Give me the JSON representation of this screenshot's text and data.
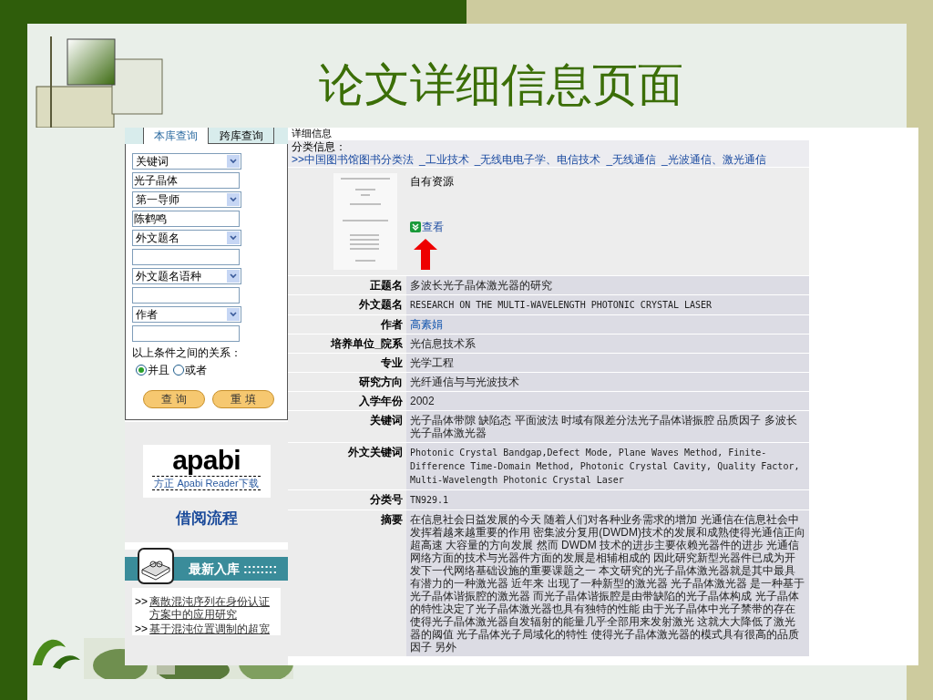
{
  "slide_title": "论文详细信息页面",
  "search_panel": {
    "tabs": [
      {
        "label": "本库查询",
        "selected": true
      },
      {
        "label": "跨库查询",
        "selected": false
      }
    ],
    "fields": [
      {
        "kind": "select",
        "value": "关键词"
      },
      {
        "kind": "input",
        "value": "光子晶体"
      },
      {
        "kind": "select",
        "value": "第一导师"
      },
      {
        "kind": "input",
        "value": "陈鹤鸣"
      },
      {
        "kind": "select",
        "value": "外文题名"
      },
      {
        "kind": "input"
      },
      {
        "kind": "select",
        "value": "外文题名语种"
      },
      {
        "kind": "input"
      },
      {
        "kind": "select",
        "value": "作者"
      },
      {
        "kind": "input"
      }
    ],
    "relation_label": "以上条件之间的关系：",
    "radios": [
      {
        "label": "并且",
        "selected": true
      },
      {
        "label": "或者",
        "selected": false
      }
    ],
    "buttons": [
      "查 询",
      "重 填"
    ]
  },
  "apabi": {
    "logo_text": "apabi",
    "caption": "方正 Apabi Reader下载"
  },
  "borrow_link": "借阅流程",
  "new_arrivals": {
    "title": "最新入库 ::::::::",
    "bullet": ">>",
    "items": [
      "离散混沌序列在身份认证方案中的应用研究",
      "基于混沌位置调制的超宽"
    ]
  },
  "detail": {
    "section_title": "详细信息",
    "classification_label": "分类信息：",
    "classification_path": [
      ">>中国图书馆图书分类法",
      "_工业技术",
      "_无线电电子学、电信技术",
      "_无线通信",
      "_光波通信、激光通信"
    ],
    "resource_label": "自有资源",
    "view_link": "查看",
    "rows": [
      {
        "label": "正题名",
        "value": "多波长光子晶体激光器的研究",
        "kind": "text"
      },
      {
        "label": "外文题名",
        "value": "RESEARCH ON THE MULTI-WAVELENGTH PHOTONIC CRYSTAL LASER",
        "kind": "mono"
      },
      {
        "label": "作者",
        "value": "高素娟",
        "kind": "link"
      },
      {
        "label": "培养单位_院系",
        "value": "光信息技术系",
        "kind": "text"
      },
      {
        "label": "专业",
        "value": "光学工程",
        "kind": "text"
      },
      {
        "label": "研究方向",
        "value": "光纤通信与与光波技术",
        "kind": "text"
      },
      {
        "label": "入学年份",
        "value": "2002",
        "kind": "text"
      },
      {
        "label": "关键词",
        "value": "光子晶体带隙 缺陷态 平面波法 时域有限差分法光子晶体谐振腔 品质因子 多波长光子晶体激光器",
        "kind": "text"
      },
      {
        "label": "外文关键词",
        "value": "Photonic Crystal Bandgap,Defect Mode, Plane Waves Method, Finite-Difference Time-Domain Method, Photonic Crystal Cavity, Quality Factor, Multi-Wavelength Photonic Crystal Laser",
        "kind": "mono"
      },
      {
        "label": "分类号",
        "value": "TN929.1",
        "kind": "mono"
      },
      {
        "label": "摘要",
        "value": "在信息社会日益发展的今天 随着人们对各种业务需求的增加 光通信在信息社会中发挥着越来越重要的作用 密集波分复用(DWDM)技术的发展和成熟使得光通信正向超高速 大容量的方向发展 然而 DWDM 技术的进步主要依赖光器件的进步 光通信网络方面的技术与光器件方面的发展是相辅相成的 因此研究新型光器件已成为开发下一代网络基础设施的重要课题之一 本文研究的光子晶体激光器就是其中最具有潜力的一种激光器 近年来 出现了一种新型的激光器 光子晶体激光器 是一种基于光子晶体谐振腔的激光器 而光子晶体谐振腔是由带缺陷的光子晶体构成 光子晶体的特性决定了光子晶体激光器也具有独特的性能 由于光子晶体中光子禁带的存在使得光子晶体激光器自发辐射的能量几乎全部用来发射激光 这就大大降低了激光器的阈值 光子晶体光子局域化的特性 使得光子晶体激光器的模式具有很高的品质因子 另外",
        "kind": "text"
      }
    ]
  }
}
